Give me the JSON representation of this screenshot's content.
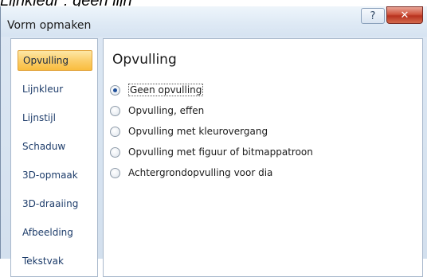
{
  "caption": "Lijnkleur : geen lijn",
  "window": {
    "title": "Vorm opmaken",
    "help_label": "?",
    "close_label": "✕"
  },
  "sidebar": {
    "items": [
      {
        "label": "Opvulling",
        "active": true
      },
      {
        "label": "Lijnkleur",
        "active": false
      },
      {
        "label": "Lijnstijl",
        "active": false
      },
      {
        "label": "Schaduw",
        "active": false
      },
      {
        "label": "3D-opmaak",
        "active": false
      },
      {
        "label": "3D-draaiing",
        "active": false
      },
      {
        "label": "Afbeelding",
        "active": false
      },
      {
        "label": "Tekstvak",
        "active": false
      }
    ]
  },
  "main": {
    "title": "Opvulling",
    "options": [
      {
        "label": "Geen opvulling",
        "checked": true
      },
      {
        "label": "Opvulling, effen",
        "checked": false
      },
      {
        "label": "Opvulling met kleurovergang",
        "checked": false
      },
      {
        "label": "Opvulling met figuur of bitmappatroon",
        "checked": false
      },
      {
        "label": "Achtergrondopvulling voor dia",
        "checked": false
      }
    ]
  },
  "colors": {
    "accent_active": "#fbcf6c",
    "close_button": "#c8452e",
    "link_text": "#1e3d6b"
  }
}
